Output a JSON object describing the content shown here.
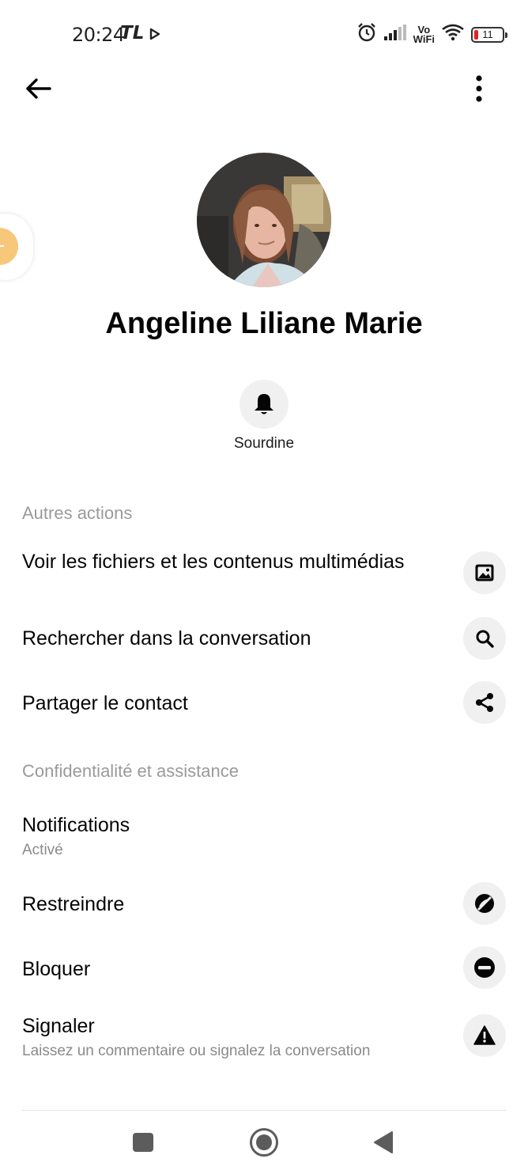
{
  "status_bar": {
    "time": "20:24",
    "carrier_badge": "TL",
    "vowifi_top": "Vo",
    "vowifi_bottom": "WiFi",
    "battery": "11",
    "icons": [
      "play-icon",
      "alarm-icon",
      "signal-icon",
      "wifi-icon",
      "battery-icon"
    ]
  },
  "header": {
    "back_icon": "arrow-left-icon",
    "more_icon": "more-vertical-icon"
  },
  "profile": {
    "name": "Angeline Liliane Marie",
    "mute_label": "Sourdine",
    "mute_icon": "bell-icon"
  },
  "sections": {
    "other_actions": {
      "title": "Autres actions",
      "items": [
        {
          "label": "Voir les fichiers et les contenus multimédias",
          "icon": "image-icon"
        },
        {
          "label": "Rechercher dans la conversation",
          "icon": "search-icon"
        },
        {
          "label": "Partager le contact",
          "icon": "share-icon"
        }
      ]
    },
    "privacy": {
      "title": "Confidentialité et assistance",
      "items": [
        {
          "label": "Notifications",
          "sublabel": "Activé"
        },
        {
          "label": "Restreindre",
          "icon": "restrict-icon"
        },
        {
          "label": "Bloquer",
          "icon": "block-icon"
        },
        {
          "label": "Signaler",
          "sublabel": "Laissez un commentaire ou signalez la conversation",
          "icon": "warning-icon"
        }
      ]
    }
  },
  "colors": {
    "icon_bg": "#f0f0f0",
    "section_title": "#9a9a9a",
    "text": "#050505",
    "battery_low": "#e02424"
  }
}
